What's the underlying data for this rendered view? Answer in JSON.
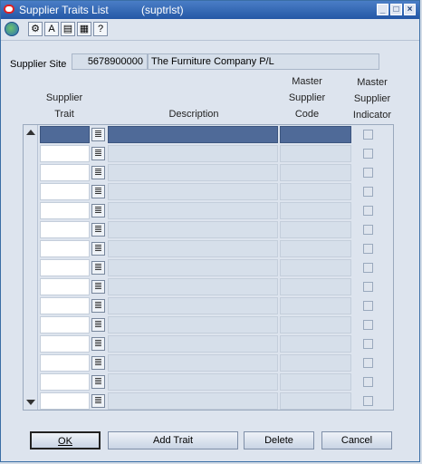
{
  "window": {
    "title": "Supplier Traits List",
    "code": "(suptrlst)",
    "controls": [
      "minimize-icon",
      "maximize-icon",
      "close-icon"
    ]
  },
  "toolbar": {
    "icons": [
      "globe-icon",
      "help-icon",
      "sort-icon",
      "list-icon",
      "print-icon",
      "question-icon"
    ]
  },
  "supplier_site": {
    "label": "Supplier Site",
    "code": "5678900000",
    "name": "The Furniture Company P/L"
  },
  "columns": {
    "trait": [
      "Supplier",
      "Trait"
    ],
    "description": [
      "Description"
    ],
    "master_code": [
      "Master",
      "Supplier",
      "Code"
    ],
    "master_indicator": [
      "Master",
      "Supplier",
      "Indicator"
    ]
  },
  "grid": {
    "rows": [
      {
        "trait": "",
        "description": "",
        "code": "",
        "selected": true
      },
      {
        "trait": "",
        "description": "",
        "code": "",
        "selected": false
      },
      {
        "trait": "",
        "description": "",
        "code": "",
        "selected": false
      },
      {
        "trait": "",
        "description": "",
        "code": "",
        "selected": false
      },
      {
        "trait": "",
        "description": "",
        "code": "",
        "selected": false
      },
      {
        "trait": "",
        "description": "",
        "code": "",
        "selected": false
      },
      {
        "trait": "",
        "description": "",
        "code": "",
        "selected": false
      },
      {
        "trait": "",
        "description": "",
        "code": "",
        "selected": false
      },
      {
        "trait": "",
        "description": "",
        "code": "",
        "selected": false
      },
      {
        "trait": "",
        "description": "",
        "code": "",
        "selected": false
      },
      {
        "trait": "",
        "description": "",
        "code": "",
        "selected": false
      },
      {
        "trait": "",
        "description": "",
        "code": "",
        "selected": false
      },
      {
        "trait": "",
        "description": "",
        "code": "",
        "selected": false
      },
      {
        "trait": "",
        "description": "",
        "code": "",
        "selected": false
      },
      {
        "trait": "",
        "description": "",
        "code": "",
        "selected": false
      }
    ]
  },
  "buttons": {
    "ok": "OK",
    "add_trait": "Add Trait",
    "delete": "Delete",
    "cancel": "Cancel"
  },
  "colors": {
    "titlebar": "#2457a6",
    "selected_row": "#4f6a98",
    "panel": "#dde4ee"
  }
}
